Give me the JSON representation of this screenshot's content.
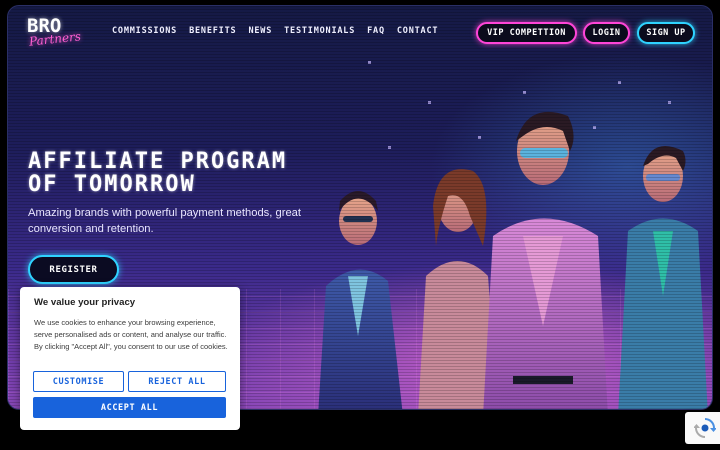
{
  "logo": {
    "main": "BRO",
    "script": "Partners"
  },
  "nav": {
    "items": [
      {
        "label": "COMMISSIONS"
      },
      {
        "label": "BENEFITS"
      },
      {
        "label": "NEWS"
      },
      {
        "label": "TESTIMONIALS"
      },
      {
        "label": "FAQ"
      },
      {
        "label": "CONTACT"
      }
    ]
  },
  "header": {
    "vip_label": "VIP COMPETTION",
    "login_label": "LOGIN",
    "signup_label": "SIGN UP"
  },
  "hero": {
    "title_line1": "AFFILIATE PROGRAM",
    "title_line2": "OF TOMORROW",
    "subtitle": "Amazing brands with powerful payment methods, great conversion and retention.",
    "register_label": "REGISTER",
    "illustration_icon": "retro-group-illustration"
  },
  "cookie": {
    "title": "We value your privacy",
    "text": "We use cookies to enhance your browsing experience, serve personalised ads or content, and analyse our traffic. By clicking \"Accept All\", you consent to our use of cookies.",
    "customise_label": "CUSTOMISE",
    "reject_label": "REJECT ALL",
    "accept_label": "ACCEPT ALL"
  },
  "recaptcha": {
    "icon": "recaptcha-icon"
  },
  "colors": {
    "accent_pink": "#ff45d8",
    "accent_cyan": "#2fd3ff",
    "cookie_blue": "#1863dc"
  }
}
